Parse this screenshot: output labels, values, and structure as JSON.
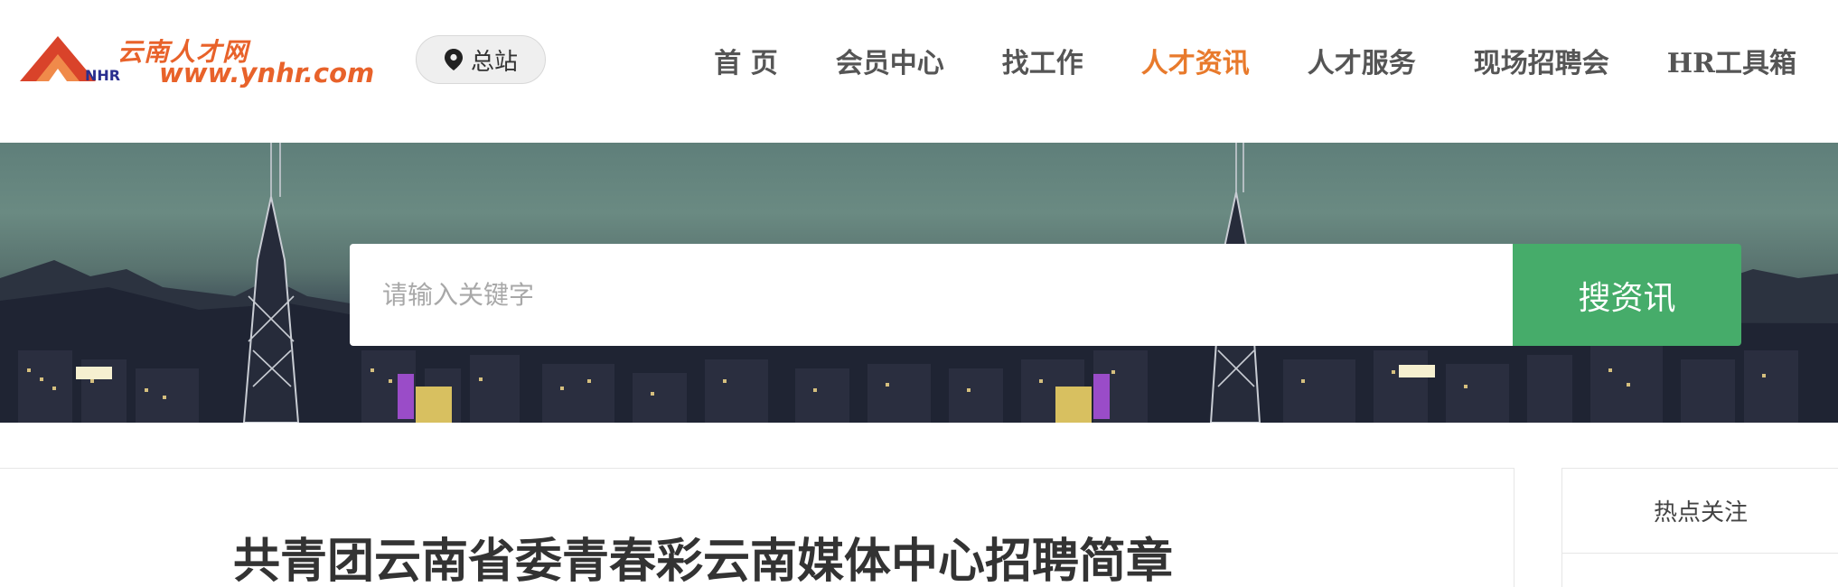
{
  "logo": {
    "cn_text": "云南人才网",
    "nhr_text": "NHR",
    "url_text": "www.ynhr.com"
  },
  "site_selector": {
    "label": "总站",
    "icon": "location-pin-icon"
  },
  "nav": {
    "items": [
      {
        "label": "首 页",
        "active": false
      },
      {
        "label": "会员中心",
        "active": false
      },
      {
        "label": "找工作",
        "active": false
      },
      {
        "label": "人才资讯",
        "active": true
      },
      {
        "label": "人才服务",
        "active": false
      },
      {
        "label": "现场招聘会",
        "active": false
      },
      {
        "label": "HR工具箱",
        "active": false
      }
    ],
    "active_color": "#e87a2c"
  },
  "search": {
    "placeholder": "请输入关键字",
    "value": "",
    "button_label": "搜资讯",
    "button_color": "#46ac6a"
  },
  "article": {
    "title": "共青团云南省委青春彩云南媒体中心招聘简章"
  },
  "sidebar": {
    "title": "热点关注",
    "partial_item": "热点关注"
  },
  "colors": {
    "brand_orange": "#e8622a",
    "brand_blue": "#2a2f8f"
  }
}
